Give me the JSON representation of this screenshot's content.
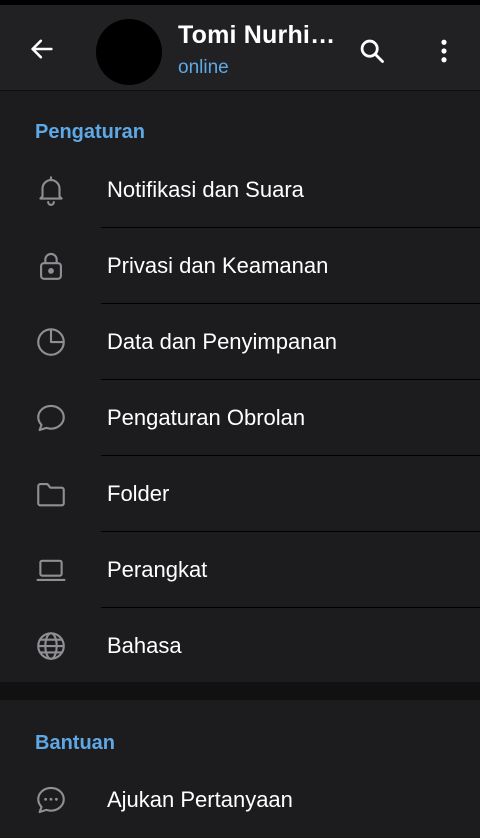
{
  "header": {
    "title": "Tomi Nurhi…",
    "status": "online",
    "icons": {
      "back": "arrow-left-icon",
      "search": "search-icon",
      "more": "more-vertical-icon"
    }
  },
  "sections": [
    {
      "title": "Pengaturan",
      "items": [
        {
          "label": "Notifikasi dan Suara",
          "icon": "bell-icon"
        },
        {
          "label": "Privasi dan Keamanan",
          "icon": "lock-icon"
        },
        {
          "label": "Data dan Penyimpanan",
          "icon": "pie-chart-icon"
        },
        {
          "label": "Pengaturan Obrolan",
          "icon": "chat-bubble-icon"
        },
        {
          "label": "Folder",
          "icon": "folder-icon"
        },
        {
          "label": "Perangkat",
          "icon": "laptop-icon"
        },
        {
          "label": "Bahasa",
          "icon": "globe-icon"
        }
      ]
    },
    {
      "title": "Bantuan",
      "items": [
        {
          "label": "Ajukan Pertanyaan",
          "icon": "chat-dots-icon"
        }
      ]
    }
  ],
  "colors": {
    "background": "#1c1c1e",
    "header": "#212124",
    "accent": "#5fa8e6",
    "icon": "#8e8e93"
  }
}
